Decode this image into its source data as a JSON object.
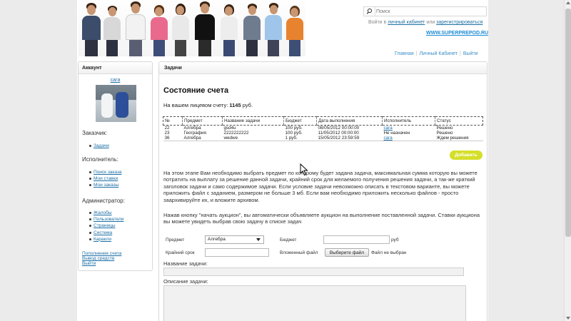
{
  "header": {
    "search_placeholder": "Поиск",
    "login_prefix": "Войти в",
    "login_link": "личный кабинет",
    "login_mid": "или",
    "register_link": "зарегистрироваться",
    "site_url": "WWW.SUPERPREPOD.RU",
    "nav": [
      "Главная",
      "Личный Кабинет",
      "Выйти"
    ]
  },
  "sidebar": {
    "title": "Аккаунт",
    "user": "сага",
    "customer_title": "Заказчик:",
    "customer_items": [
      "Задачи"
    ],
    "executor_title": "Исполнитель:",
    "executor_items": [
      "Поиск заказа",
      "Мои ставки",
      "Мои заказы"
    ],
    "admin_title": "Администратор:",
    "admin_items": [
      "Жалобы",
      "Пользователи",
      "Страницы",
      "Система",
      "Каракли"
    ],
    "links": [
      "Пополнение счета",
      "Вывод средств",
      "Выйти"
    ]
  },
  "main": {
    "panel_title": "Задачи",
    "account_title": "Состояние счета",
    "balance_prefix": "На вашем лицевом счету:",
    "balance_value": "1145",
    "balance_unit": "руб.",
    "add_button": "Добавить",
    "instructions_1": "На этом этапе Вам необходимо выбрать предмет по которому будет задана задача, максимальная сумма которую вы можете потратить на выплату за решение данной задачи, крайний срок для желаемого получения решения задачи, а так-же краткий заголовок задачи и само содержимое задачи. Если условие задачи невозможно описать в текстовом варианте, вы можете приложить файл с заданием, размером не больше 3 мб. Если вам необходимо приложить несколько файлов - просто заархивируйте их, и вложите архивом.",
    "instructions_2": "Нажав кнопку \"начать аукцион\", вы автоматически объявляете аукцион на выполнение поставленной задачи. Ставки аукциона вы можете увидеть выбрав свою задачу в списке задач"
  },
  "table": {
    "headers": [
      "№",
      "Предмет",
      "Название задачи",
      "Бюджет",
      "Дата выполнения",
      "Исполнитель",
      "Статус"
    ],
    "rows": [
      [
        "22",
        "Алгебра",
        "gsd4u",
        "100 руб.",
        "08/05/2012 00:00:00",
        "сага",
        "Решено"
      ],
      [
        "23",
        "География",
        "2222222222",
        "100 руб.",
        "11/05/2012 00:00:00",
        "Не назначен",
        "Решено"
      ],
      [
        "36",
        "Алгебра",
        "wedwe",
        "1 руб.",
        "15/05/2012 23:59:59",
        "сага",
        "Ждем решения"
      ]
    ]
  },
  "form": {
    "subject_label": "Предмет",
    "subject_value": "Алгебра",
    "budget_label": "Бюджет",
    "budget_unit": "руб",
    "deadline_label": "Крайний срок",
    "file_label": "Вложенный файл",
    "file_button": "Выберите файл",
    "file_status": "Файл не выбран",
    "title_label": "Название задачи:",
    "desc_label": "Описание задачи:"
  }
}
